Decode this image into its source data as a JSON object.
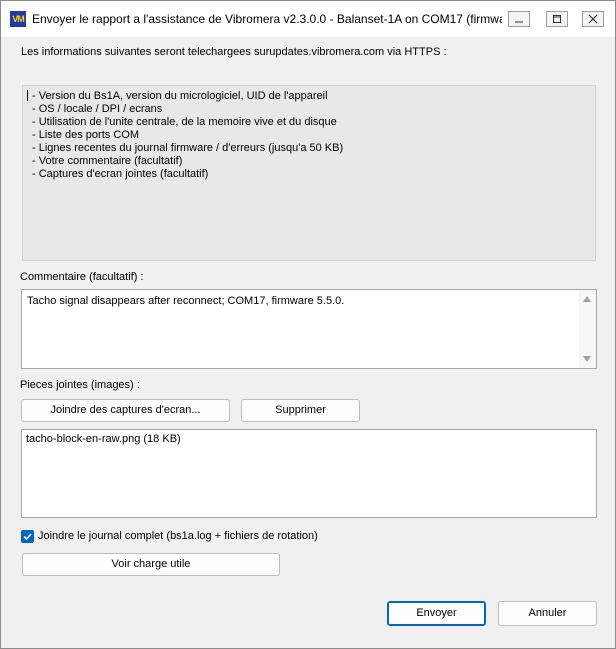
{
  "window": {
    "title": "Envoyer le rapport a l'assistance de Vibromera v2.3.0.0 - Balanset-1A on COM17 (firmwa",
    "app_icon_text": "VM"
  },
  "intro": "Les informations suivantes seront telechargees surupdates.vibromera.com via HTTPS :",
  "info_items": [
    "- Version du Bs1A, version du micrologiciel, UID de l'appareil",
    "- OS / locale / DPI / ecrans",
    "- Utilisation de l'unite centrale, de la memoire vive et du disque",
    "- Liste des ports COM",
    "- Lignes recentes du journal firmware / d'erreurs (jusqu'a 50 KB)",
    "- Votre commentaire (facultatif)",
    "- Captures d'ecran jointes (facultatif)"
  ],
  "comment": {
    "label": "Commentaire (facultatif) :",
    "value": "Tacho signal disappears after reconnect; COM17, firmware 5.5.0."
  },
  "attachments": {
    "label": "Pieces jointes (images) :",
    "add_button": "Joindre des captures d'ecran...",
    "remove_button": "Supprimer",
    "items": [
      "tacho-block-en-raw.png (18 KB)"
    ]
  },
  "full_log": {
    "label": "Joindre le journal complet (bs1a.log + fichiers de rotation)",
    "checked": true
  },
  "preview_button": "Voir charge utile",
  "send_button": "Envoyer",
  "cancel_button": "Annuler",
  "colors": {
    "accent": "#0067c0",
    "icon_bg": "#1f3aa8",
    "icon_fg": "#ffd200"
  }
}
